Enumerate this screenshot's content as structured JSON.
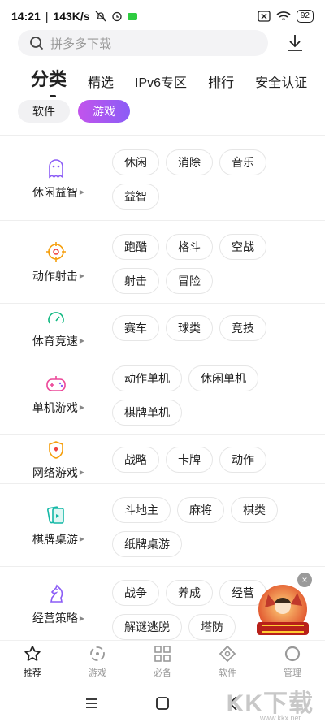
{
  "status_bar": {
    "time": "14:21",
    "speed": "143K/s",
    "battery": "92"
  },
  "search": {
    "placeholder": "拼多多下载"
  },
  "top_tabs": [
    {
      "label": "分类",
      "active": true
    },
    {
      "label": "精选"
    },
    {
      "label": "IPv6专区"
    },
    {
      "label": "排行"
    },
    {
      "label": "安全认证"
    }
  ],
  "sub_tabs": [
    {
      "label": "软件"
    },
    {
      "label": "游戏",
      "active": true
    }
  ],
  "categories": [
    {
      "name": "休闲益智",
      "icon": "ghost-icon",
      "color": "#8b5cf6",
      "tags": [
        "休闲",
        "消除",
        "音乐",
        "益智"
      ]
    },
    {
      "name": "动作射击",
      "icon": "crosshair-icon",
      "color": "#f59e0b",
      "tags": [
        "跑酷",
        "格斗",
        "空战",
        "射击",
        "冒险"
      ]
    },
    {
      "name": "体育竞速",
      "icon": "speedometer-icon",
      "color": "#10b981",
      "tags": [
        "赛车",
        "球类",
        "竞技"
      ]
    },
    {
      "name": "单机游戏",
      "icon": "gamepad-icon",
      "color": "#ec4899",
      "tags": [
        "动作单机",
        "休闲单机",
        "棋牌单机"
      ]
    },
    {
      "name": "网络游戏",
      "icon": "shield-icon",
      "color": "#f59e0b",
      "tags": [
        "战略",
        "卡牌",
        "动作"
      ]
    },
    {
      "name": "棋牌桌游",
      "icon": "cards-icon",
      "color": "#14b8a6",
      "tags": [
        "斗地主",
        "麻将",
        "棋类",
        "纸牌桌游"
      ]
    },
    {
      "name": "经营策略",
      "icon": "chess-knight-icon",
      "color": "#8b5cf6",
      "tags": [
        "战争",
        "养成",
        "经营",
        "解谜逃脱",
        "塔防"
      ]
    }
  ],
  "float_ad": {
    "close": "×"
  },
  "bottom_nav": [
    {
      "label": "推荐",
      "icon": "star-icon",
      "active": true
    },
    {
      "label": "游戏",
      "icon": "game-icon"
    },
    {
      "label": "必备",
      "icon": "grid-icon"
    },
    {
      "label": "软件",
      "icon": "diamond-icon"
    },
    {
      "label": "管理",
      "icon": "ring-icon"
    }
  ],
  "watermark": {
    "text": "KK下载",
    "url": "www.kkx.net"
  }
}
